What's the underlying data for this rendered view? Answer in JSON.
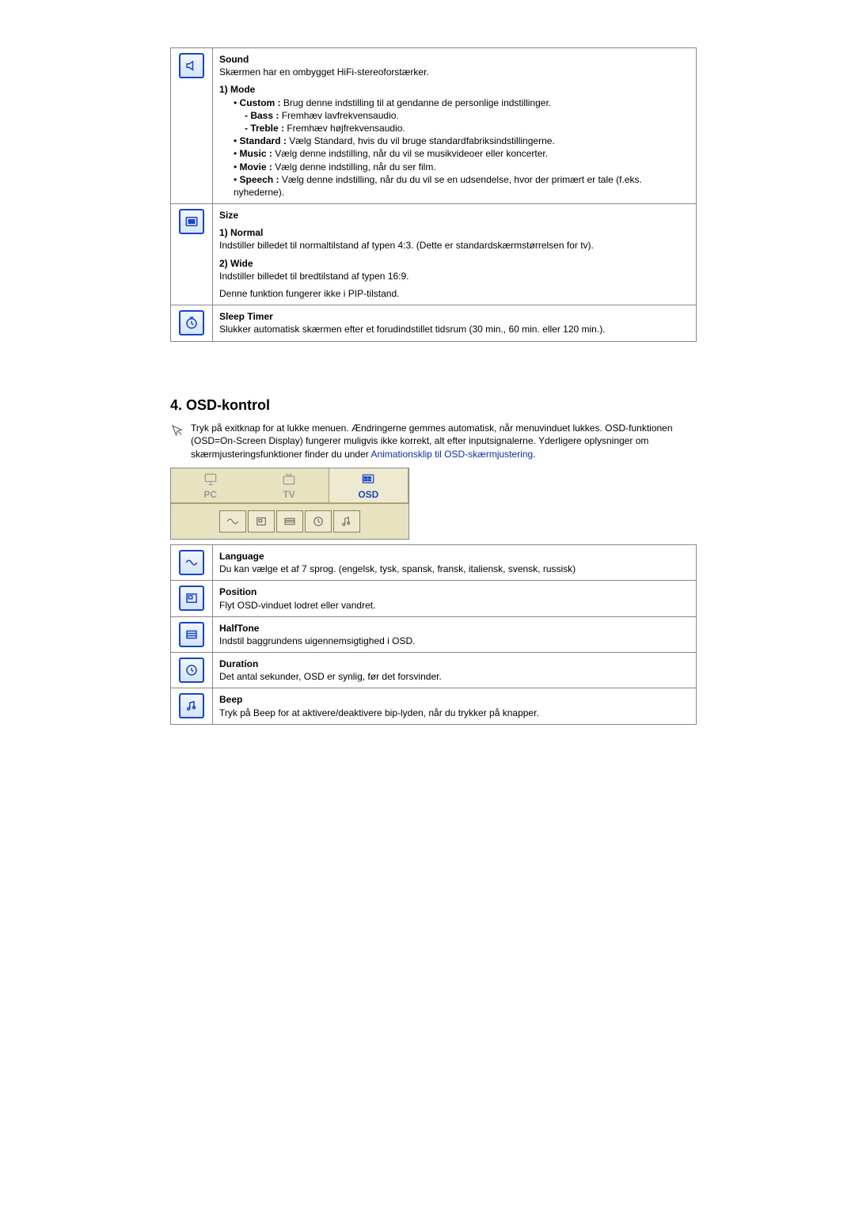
{
  "sound": {
    "title": "Sound",
    "intro": "Skærmen har en ombygget HiFi-stereoforstærker.",
    "mode_title": "1) Mode",
    "custom_label": "Custom :",
    "custom_text": " Brug denne indstilling til at gendanne de personlige indstillinger.",
    "bass_label": "- Bass :",
    "bass_text": " Fremhæv lavfrekvensaudio.",
    "treble_label": "- Treble :",
    "treble_text": " Fremhæv højfrekvensaudio.",
    "standard_label": "Standard :",
    "standard_text": " Vælg Standard, hvis du vil bruge standardfabriksindstillingerne.",
    "music_label": "Music :",
    "music_text": " Vælg denne indstilling, når du vil se musikvideoer eller koncerter.",
    "movie_label": "Movie :",
    "movie_text": " Vælg denne indstilling, når du ser film.",
    "speech_label": "Speech :",
    "speech_text": " Vælg denne indstilling, når du du vil se en udsendelse, hvor der primært er tale (f.eks. nyhederne)."
  },
  "size": {
    "title": "Size",
    "normal_title": "1) Normal",
    "normal_text": "Indstiller billedet til normaltilstand af typen 4:3. (Dette er standardskærmstørrelsen for tv).",
    "wide_title": "2) Wide",
    "wide_text": "Indstiller billedet til bredtilstand af typen 16:9.",
    "note": "Denne funktion fungerer ikke i PIP-tilstand."
  },
  "sleep": {
    "title": "Sleep Timer",
    "text": "Slukker automatisk skærmen efter et forudindstillet tidsrum (30 min., 60 min. eller 120 min.)."
  },
  "osd": {
    "heading": "4. OSD-kontrol",
    "intro1": "Tryk på exitknap for at lukke menuen. Ændringerne gemmes automatisk, når menuvinduet lukkes. OSD-funktionen (OSD=On-Screen Display) fungerer muligvis ikke korrekt, alt efter inputsignalerne. Yderligere oplysninger om skærmjusteringsfunktioner finder du under ",
    "link": "Animationsklip til OSD-skærmjustering",
    "intro2": ".",
    "tabs": {
      "pc": "PC",
      "tv": "TV",
      "osd": "OSD"
    },
    "language": {
      "title": "Language",
      "text": "Du kan vælge et af 7 sprog. (engelsk, tysk, spansk, fransk, italiensk, svensk, russisk)"
    },
    "position": {
      "title": "Position",
      "text": "Flyt OSD-vinduet lodret eller vandret."
    },
    "halftone": {
      "title": "HalfTone",
      "text": "Indstil baggrundens uigennemsigtighed i OSD."
    },
    "duration": {
      "title": "Duration",
      "text": "Det antal sekunder, OSD er synlig, før det forsvinder."
    },
    "beep": {
      "title": "Beep",
      "text": "Tryk på Beep for at aktivere/deaktivere bip-lyden, når du trykker på knapper."
    }
  }
}
